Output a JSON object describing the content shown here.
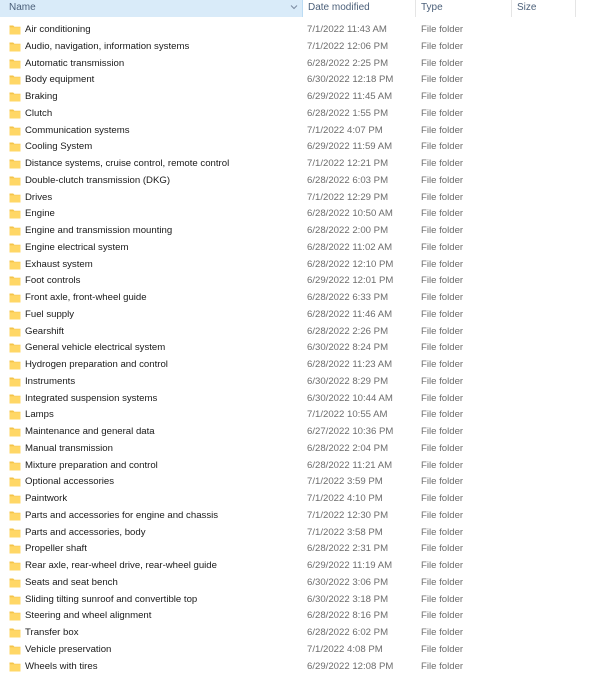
{
  "columns": {
    "name": "Name",
    "date": "Date modified",
    "type": "Type",
    "size": "Size"
  },
  "colors": {
    "header_selected_bg": "#d9ebf9",
    "folder_fill": "#ffd766",
    "folder_tab": "#f4c44a",
    "header_text": "#4c607a",
    "secondary_text": "#6d6d6d"
  },
  "icons": {
    "folder": "folder-icon",
    "sort": "chevron-down-icon"
  },
  "files": [
    {
      "name": "Air conditioning",
      "date": "7/1/2022 11:43 AM",
      "type": "File folder"
    },
    {
      "name": "Audio, navigation, information systems",
      "date": "7/1/2022 12:06 PM",
      "type": "File folder"
    },
    {
      "name": "Automatic transmission",
      "date": "6/28/2022 2:25 PM",
      "type": "File folder"
    },
    {
      "name": "Body equipment",
      "date": "6/30/2022 12:18 PM",
      "type": "File folder"
    },
    {
      "name": "Braking",
      "date": "6/29/2022 11:45 AM",
      "type": "File folder"
    },
    {
      "name": "Clutch",
      "date": "6/28/2022 1:55 PM",
      "type": "File folder"
    },
    {
      "name": "Communication systems",
      "date": "7/1/2022 4:07 PM",
      "type": "File folder"
    },
    {
      "name": "Cooling System",
      "date": "6/29/2022 11:59 AM",
      "type": "File folder"
    },
    {
      "name": "Distance systems, cruise control, remote control",
      "date": "7/1/2022 12:21 PM",
      "type": "File folder"
    },
    {
      "name": "Double-clutch transmission (DKG)",
      "date": "6/28/2022 6:03 PM",
      "type": "File folder"
    },
    {
      "name": "Drives",
      "date": "7/1/2022 12:29 PM",
      "type": "File folder"
    },
    {
      "name": "Engine",
      "date": "6/28/2022 10:50 AM",
      "type": "File folder"
    },
    {
      "name": "Engine and transmission mounting",
      "date": "6/28/2022 2:00 PM",
      "type": "File folder"
    },
    {
      "name": "Engine electrical system",
      "date": "6/28/2022 11:02 AM",
      "type": "File folder"
    },
    {
      "name": "Exhaust system",
      "date": "6/28/2022 12:10 PM",
      "type": "File folder"
    },
    {
      "name": "Foot controls",
      "date": "6/29/2022 12:01 PM",
      "type": "File folder"
    },
    {
      "name": "Front axle, front-wheel guide",
      "date": "6/28/2022 6:33 PM",
      "type": "File folder"
    },
    {
      "name": "Fuel supply",
      "date": "6/28/2022 11:46 AM",
      "type": "File folder"
    },
    {
      "name": "Gearshift",
      "date": "6/28/2022 2:26 PM",
      "type": "File folder"
    },
    {
      "name": "General vehicle electrical system",
      "date": "6/30/2022 8:24 PM",
      "type": "File folder"
    },
    {
      "name": "Hydrogen preparation and control",
      "date": "6/28/2022 11:23 AM",
      "type": "File folder"
    },
    {
      "name": "Instruments",
      "date": "6/30/2022 8:29 PM",
      "type": "File folder"
    },
    {
      "name": "Integrated suspension systems",
      "date": "6/30/2022 10:44 AM",
      "type": "File folder"
    },
    {
      "name": "Lamps",
      "date": "7/1/2022 10:55 AM",
      "type": "File folder"
    },
    {
      "name": "Maintenance and general data",
      "date": "6/27/2022 10:36 PM",
      "type": "File folder"
    },
    {
      "name": "Manual transmission",
      "date": "6/28/2022 2:04 PM",
      "type": "File folder"
    },
    {
      "name": "Mixture preparation and control",
      "date": "6/28/2022 11:21 AM",
      "type": "File folder"
    },
    {
      "name": "Optional accessories",
      "date": "7/1/2022 3:59 PM",
      "type": "File folder"
    },
    {
      "name": "Paintwork",
      "date": "7/1/2022 4:10 PM",
      "type": "File folder"
    },
    {
      "name": "Parts and accessories for engine and chassis",
      "date": "7/1/2022 12:30 PM",
      "type": "File folder"
    },
    {
      "name": "Parts and accessories, body",
      "date": "7/1/2022 3:58 PM",
      "type": "File folder"
    },
    {
      "name": "Propeller shaft",
      "date": "6/28/2022 2:31 PM",
      "type": "File folder"
    },
    {
      "name": "Rear axle, rear-wheel drive, rear-wheel guide",
      "date": "6/29/2022 11:19 AM",
      "type": "File folder"
    },
    {
      "name": "Seats and seat bench",
      "date": "6/30/2022 3:06 PM",
      "type": "File folder"
    },
    {
      "name": "Sliding  tilting sunroof and convertible top",
      "date": "6/30/2022 3:18 PM",
      "type": "File folder"
    },
    {
      "name": "Steering and wheel alignment",
      "date": "6/28/2022 8:16 PM",
      "type": "File folder"
    },
    {
      "name": "Transfer box",
      "date": "6/28/2022 6:02 PM",
      "type": "File folder"
    },
    {
      "name": "Vehicle preservation",
      "date": "7/1/2022 4:08 PM",
      "type": "File folder"
    },
    {
      "name": "Wheels with tires",
      "date": "6/29/2022 12:08 PM",
      "type": "File folder"
    }
  ]
}
